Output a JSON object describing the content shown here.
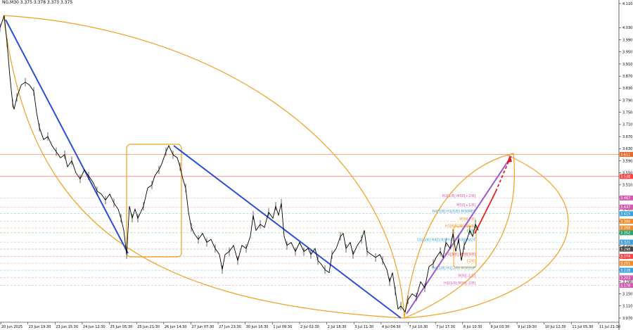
{
  "symbol_label": "NG,M30 3.375 3.378 3.373 3.375",
  "chart_data": {
    "type": "line",
    "symbol": "NG",
    "timeframe": "M30",
    "ohlc_readout": {
      "open": 3.375,
      "high": 3.378,
      "low": 3.373,
      "close": 3.375
    },
    "ylim": [
      3.07,
      4.11
    ],
    "y_ticks": [
      "4.110",
      "4.030",
      "3.990",
      "3.950",
      "3.910",
      "3.870",
      "3.830",
      "3.790",
      "3.750",
      "3.710",
      "3.670",
      "3.630",
      "3.590",
      "3.550",
      "3.510",
      "3.470",
      "3.430",
      "3.390",
      "3.350",
      "3.310",
      "3.270",
      "3.230",
      "3.190",
      "3.150",
      "3.110",
      "3.070"
    ],
    "x_ticks": [
      "20 Jun 2025",
      "23 Jun 19:30",
      "23 Jun 15:30",
      "24 Jun 12:30",
      "25 Jun 05:30",
      "25 Jun 21:30",
      "26 Jun 14:30",
      "27 Jun 07:30",
      "27 Jun 23:30",
      "30 Jun 16:30",
      "1 Jul 09:30",
      "2 Jul 02:30",
      "2 Jul 18:30",
      "3 Jul 11:30",
      "4 Jul 04:30",
      "7 Jul 10:30",
      "7 Jul 17:30",
      "8 Jul 10:30",
      "9 Jul 03:30",
      "9 Jul 19:30",
      "10 Jul 12:30",
      "11 Jul 05:30",
      "11 Jul 21:30"
    ],
    "price_path": [
      [
        0,
        4.03
      ],
      [
        6,
        4.07
      ],
      [
        10,
        3.98
      ],
      [
        14,
        3.87
      ],
      [
        18,
        3.78
      ],
      [
        20,
        3.76
      ],
      [
        24,
        3.8
      ],
      [
        30,
        3.84
      ],
      [
        36,
        3.85
      ],
      [
        42,
        3.84
      ],
      [
        48,
        3.82
      ],
      [
        52,
        3.75
      ],
      [
        56,
        3.7
      ],
      [
        62,
        3.66
      ],
      [
        68,
        3.67
      ],
      [
        74,
        3.64
      ],
      [
        80,
        3.62
      ],
      [
        86,
        3.6
      ],
      [
        92,
        3.61
      ],
      [
        96,
        3.57
      ],
      [
        102,
        3.59
      ],
      [
        108,
        3.55
      ],
      [
        114,
        3.53
      ],
      [
        120,
        3.56
      ],
      [
        126,
        3.54
      ],
      [
        132,
        3.52
      ],
      [
        138,
        3.49
      ],
      [
        144,
        3.48
      ],
      [
        150,
        3.46
      ],
      [
        156,
        3.48
      ],
      [
        162,
        3.45
      ],
      [
        168,
        3.43
      ],
      [
        172,
        3.4
      ],
      [
        176,
        3.36
      ],
      [
        180,
        3.28
      ],
      [
        184,
        3.44
      ],
      [
        188,
        3.4
      ],
      [
        192,
        3.43
      ],
      [
        196,
        3.4
      ],
      [
        200,
        3.42
      ],
      [
        204,
        3.44
      ],
      [
        210,
        3.5
      ],
      [
        216,
        3.51
      ],
      [
        220,
        3.54
      ],
      [
        226,
        3.56
      ],
      [
        230,
        3.58
      ],
      [
        236,
        3.62
      ],
      [
        240,
        3.64
      ],
      [
        246,
        3.61
      ],
      [
        252,
        3.6
      ],
      [
        256,
        3.57
      ],
      [
        260,
        3.53
      ],
      [
        264,
        3.5
      ],
      [
        268,
        3.42
      ],
      [
        272,
        3.37
      ],
      [
        276,
        3.35
      ],
      [
        282,
        3.33
      ],
      [
        288,
        3.35
      ],
      [
        294,
        3.32
      ],
      [
        300,
        3.33
      ],
      [
        306,
        3.3
      ],
      [
        312,
        3.28
      ],
      [
        316,
        3.23
      ],
      [
        320,
        3.28
      ],
      [
        326,
        3.29
      ],
      [
        332,
        3.31
      ],
      [
        338,
        3.26
      ],
      [
        344,
        3.31
      ],
      [
        350,
        3.3
      ],
      [
        356,
        3.34
      ],
      [
        360,
        3.41
      ],
      [
        364,
        3.36
      ],
      [
        370,
        3.38
      ],
      [
        376,
        3.37
      ],
      [
        382,
        3.42
      ],
      [
        388,
        3.4
      ],
      [
        392,
        3.44
      ],
      [
        396,
        3.41
      ],
      [
        400,
        3.45
      ],
      [
        404,
        3.34
      ],
      [
        408,
        3.31
      ],
      [
        414,
        3.32
      ],
      [
        420,
        3.29
      ],
      [
        426,
        3.32
      ],
      [
        432,
        3.29
      ],
      [
        438,
        3.3
      ],
      [
        442,
        3.28
      ],
      [
        448,
        3.3
      ],
      [
        452,
        3.26
      ],
      [
        456,
        3.25
      ],
      [
        462,
        3.23
      ],
      [
        468,
        3.22
      ],
      [
        472,
        3.28
      ],
      [
        478,
        3.3
      ],
      [
        484,
        3.34
      ],
      [
        488,
        3.35
      ],
      [
        492,
        3.3
      ],
      [
        498,
        3.32
      ],
      [
        502,
        3.28
      ],
      [
        508,
        3.31
      ],
      [
        514,
        3.33
      ],
      [
        518,
        3.36
      ],
      [
        522,
        3.29
      ],
      [
        528,
        3.28
      ],
      [
        534,
        3.27
      ],
      [
        540,
        3.28
      ],
      [
        544,
        3.26
      ],
      [
        550,
        3.23
      ],
      [
        554,
        3.19
      ],
      [
        558,
        3.22
      ],
      [
        562,
        3.16
      ],
      [
        566,
        3.1
      ],
      [
        570,
        3.11
      ],
      [
        576,
        3.09
      ],
      [
        580,
        3.13
      ],
      [
        586,
        3.15
      ],
      [
        592,
        3.14
      ],
      [
        598,
        3.19
      ],
      [
        604,
        3.17
      ],
      [
        610,
        3.24
      ],
      [
        616,
        3.25
      ],
      [
        620,
        3.27
      ],
      [
        626,
        3.29
      ],
      [
        630,
        3.27
      ],
      [
        634,
        3.32
      ],
      [
        640,
        3.3
      ],
      [
        644,
        3.35
      ],
      [
        648,
        3.29
      ],
      [
        652,
        3.33
      ],
      [
        656,
        3.26
      ],
      [
        660,
        3.31
      ],
      [
        664,
        3.33
      ],
      [
        668,
        3.36
      ],
      [
        672,
        3.34
      ],
      [
        676,
        3.38
      ],
      [
        680,
        3.36
      ]
    ],
    "levels": [
      {
        "price": 3.611,
        "label": "",
        "color": "#e86a2a",
        "tag": "3.611"
      },
      {
        "price": 3.538,
        "label": "",
        "color": "#ff4444",
        "tag": "3.538"
      },
      {
        "price": 3.467,
        "label": "H1[1/8] M30[+2/8]",
        "color": "#d45ab0",
        "tag": "3.467"
      },
      {
        "price": 3.437,
        "label": "M30[+1/8]",
        "color": "#d45ab0",
        "tag": "3.437"
      },
      {
        "price": 3.415,
        "label": "H4[3/8] H1[0/8] M30RES",
        "color": "#3aa0e0",
        "tag": "3.415"
      },
      {
        "price": 3.39,
        "label": "M30[7/8]",
        "color": "#f28c28",
        "tag": "3.390"
      },
      {
        "price": 3.368,
        "label": "H1[8/8] M30[6/8]",
        "color": "#f28c28",
        "tag": "3.368"
      },
      {
        "price": 3.352,
        "label": "[5/8]",
        "color": "#2fa36b",
        "tag": "3.352"
      },
      {
        "price": 3.321,
        "label": "D1[0/8] H4[1/8] PIVOT M30PIVOT",
        "color": "#3aa0e0",
        "tag": "3.321"
      },
      {
        "price": 3.298,
        "label": "",
        "color": "#444444",
        "tag": "3.298"
      },
      {
        "price": 3.274,
        "label": "H1[3/8] M30[3/8]",
        "color": "#ff4444",
        "tag": "3.274"
      },
      {
        "price": 3.251,
        "label": "[2/8]",
        "color": "#f28c28",
        "tag": "3.251"
      },
      {
        "price": 3.228,
        "label": "H4[1/8] H1[2/8] M30SUP",
        "color": "#3aa0e0",
        "tag": "3.228"
      },
      {
        "price": 3.203,
        "label": "M30[-1/8]",
        "color": "#d45ab0",
        "tag": "3.203"
      },
      {
        "price": 3.178,
        "label": "H1[1/8] M30[-2/8]",
        "color": "#d45ab0",
        "tag": "3.178"
      }
    ],
    "grid": false,
    "background": "#ffffff"
  }
}
